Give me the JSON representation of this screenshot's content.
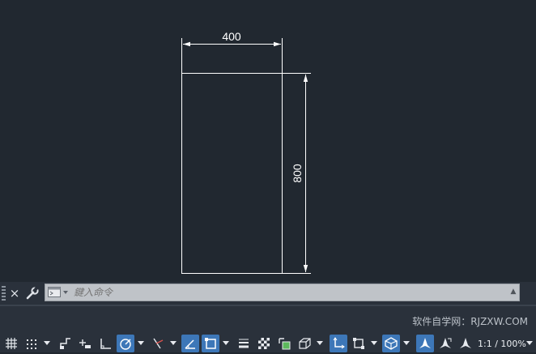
{
  "drawing": {
    "width_dimension": "400",
    "height_dimension": "800"
  },
  "command_line": {
    "placeholder": "鍵入命令",
    "close_icon": "×"
  },
  "watermark": "软件自学网：RJZXW.COM",
  "statusbar": {
    "icons": [
      "grid-icon",
      "snap-icon",
      "infer-constraints-icon",
      "dynamic-input-icon",
      "ortho-icon",
      "polar-tracking-icon",
      "isodraft-icon",
      "object-snap-tracking-icon",
      "object-snap-icon",
      "lineweight-icon",
      "transparency-icon",
      "selection-cycling-icon",
      "3d-object-snap-icon",
      "dynamic-ucs-icon",
      "selection-filter-icon",
      "gizmo-icon",
      "annotation-visibility-icon",
      "auto-scale-icon",
      "annotation-scale-icon"
    ],
    "scale_label": "1:1 / 100%",
    "accent_color": "#3d77b8"
  },
  "colors": {
    "canvas_background": "#212830",
    "drawing_lines": "#ffffff"
  }
}
